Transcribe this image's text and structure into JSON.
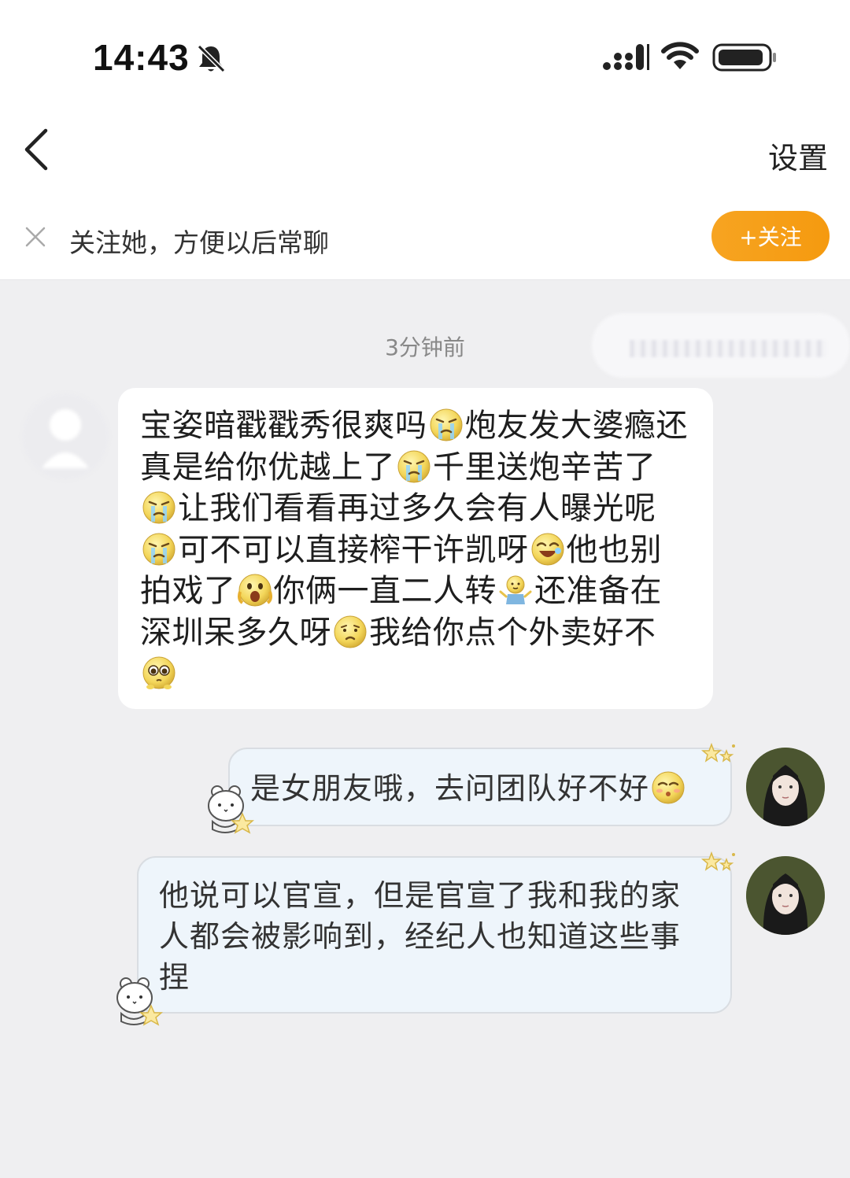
{
  "status_bar": {
    "time": "14:43",
    "icons": [
      "bell-off-icon",
      "signal-icon",
      "wifi-icon",
      "battery-icon"
    ]
  },
  "nav": {
    "back_icon": "chevron-left-icon",
    "settings_label": "设置"
  },
  "follow_banner": {
    "close_icon": "close-icon",
    "text": "关注她，方便以后常聊",
    "button_label": "+关注",
    "button_color": "#f7a421"
  },
  "chat": {
    "timestamp": "3分钟前",
    "messages": [
      {
        "side": "left",
        "segments": [
          {
            "text": "宝姿暗戳戳秀很爽吗"
          },
          {
            "emoji": "cry-emoji"
          },
          {
            "text": "炮友发大婆瘾还真是给你优越上了"
          },
          {
            "emoji": "cry-emoji"
          },
          {
            "text": "千里送炮辛苦了"
          },
          {
            "emoji": "cry-emoji"
          },
          {
            "text": "让我们看看再过多久会有人曝光呢"
          },
          {
            "emoji": "cry-emoji"
          },
          {
            "text": "可不可以直接榨干许凯呀"
          },
          {
            "emoji": "laugh-emoji"
          },
          {
            "text": "他也别拍戏了"
          },
          {
            "emoji": "scream-emoji"
          },
          {
            "text": "你俩一直二人转"
          },
          {
            "emoji": "dance-emoji"
          },
          {
            "text": "还准备在深圳呆多久呀"
          },
          {
            "emoji": "pout-emoji"
          },
          {
            "text": "我给你点个外卖好不"
          },
          {
            "emoji": "pleading-emoji"
          }
        ]
      },
      {
        "side": "right",
        "text": "是女朋友哦，去问团队好不好",
        "emoji": "wink-emoji"
      },
      {
        "side": "right",
        "text": "他说可以官宣，但是官宣了我和我的家人都会被影响到，经纪人也知道这些事捏"
      }
    ]
  },
  "colors": {
    "chat_bg": "#efeff1",
    "bubble_right_bg": "#eef5fb",
    "accent_orange": "#f7a421"
  }
}
